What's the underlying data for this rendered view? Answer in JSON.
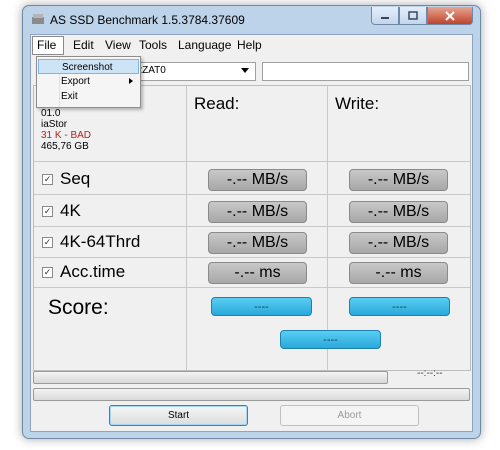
{
  "window": {
    "title": "AS SSD Benchmark 1.5.3784.37609"
  },
  "menu": {
    "items": [
      "File",
      "Edit",
      "View",
      "Tools",
      "Language",
      "Help"
    ]
  },
  "file_menu": {
    "items": [
      "Screenshot",
      "Export",
      "Exit"
    ]
  },
  "drive_select": {
    "value": "22ZAT0"
  },
  "path_field": {
    "value": ""
  },
  "drive_info": {
    "line1": "01.0",
    "line2": "iaStor",
    "line3": "31 K - BAD",
    "line4": "465,76 GB"
  },
  "columns": {
    "read": "Read:",
    "write": "Write:"
  },
  "tests": [
    {
      "label": "Seq",
      "checked": true,
      "read": "-.-- MB/s",
      "write": "-.-- MB/s"
    },
    {
      "label": "4K",
      "checked": true,
      "read": "-.-- MB/s",
      "write": "-.-- MB/s"
    },
    {
      "label": "4K-64Thrd",
      "checked": true,
      "read": "-.-- MB/s",
      "write": "-.-- MB/s"
    },
    {
      "label": "Acc.time",
      "checked": true,
      "read": "-.-- ms",
      "write": "-.-- ms"
    }
  ],
  "score": {
    "label": "Score:",
    "read": "----",
    "write": "----",
    "total": "----"
  },
  "progress": {
    "timer": "--:--:--",
    "value1": 0,
    "value2": 0
  },
  "buttons": {
    "start": "Start",
    "abort": "Abort"
  },
  "colors": {
    "score_button": "#2aa8dc",
    "bad_text": "#b22222"
  }
}
